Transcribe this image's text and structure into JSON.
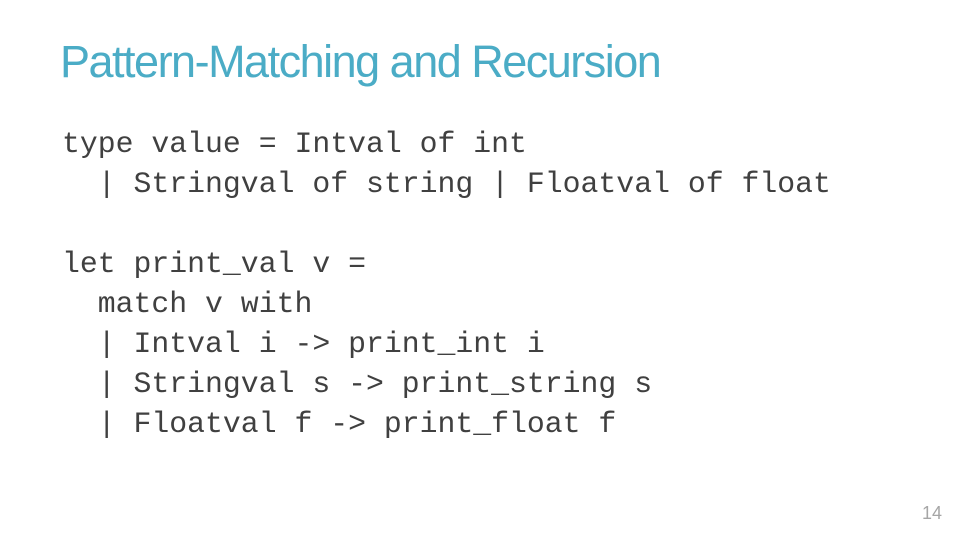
{
  "slide": {
    "title": "Pattern-Matching and Recursion",
    "code_lines": [
      "type value = Intval of int",
      "  | Stringval of string | Floatval of float",
      "",
      "let print_val v =",
      "  match v with",
      "  | Intval i -> print_int i",
      "  | Stringval s -> print_string s",
      "  | Floatval f -> print_float f"
    ],
    "page_number": "14",
    "accent_color": "#4bacc6"
  }
}
